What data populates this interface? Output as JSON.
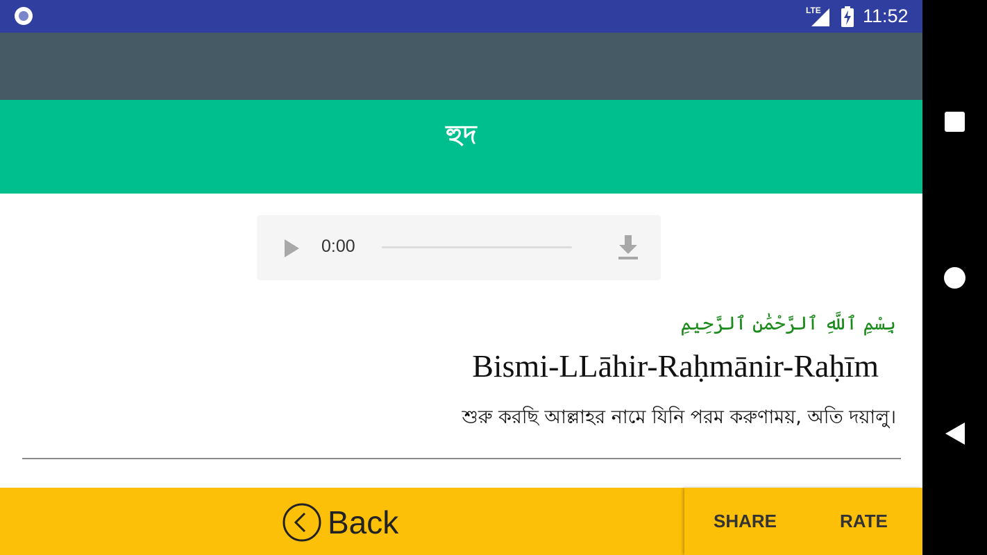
{
  "status_bar": {
    "network": "LTE",
    "time": "11:52",
    "icons": [
      "app-notification-icon",
      "signal-icon",
      "battery-charging-icon"
    ]
  },
  "header": {
    "title": "হুদ"
  },
  "audio_player": {
    "time": "0:00",
    "progress": 0,
    "icons": [
      "play-icon",
      "download-icon"
    ]
  },
  "verse": {
    "arabic": "بِسْمِ ٱللَّهِ ٱلرَّحْمَٰنِ ٱلرَّحِيمِ",
    "transliteration": "Bismi-LLāhir-Raḥmānir-Raḥīm",
    "translation": "শুরু করছি আল্লাহর নামে যিনি পরম করুণাময়, অতি দয়ালু।"
  },
  "bottom_bar": {
    "back_label": "Back",
    "share_label": "SHARE",
    "rate_label": "RATE",
    "icons": [
      "back-circle-icon"
    ]
  },
  "colors": {
    "status_bar": "#303f9f",
    "toolbar": "#455a64",
    "title_bar": "#00bf8f",
    "bottom_bar": "#fdc009",
    "arabic_text": "#1a8a1a"
  },
  "nav_bar": {
    "icons": [
      "recents-icon",
      "home-icon",
      "back-icon"
    ]
  }
}
